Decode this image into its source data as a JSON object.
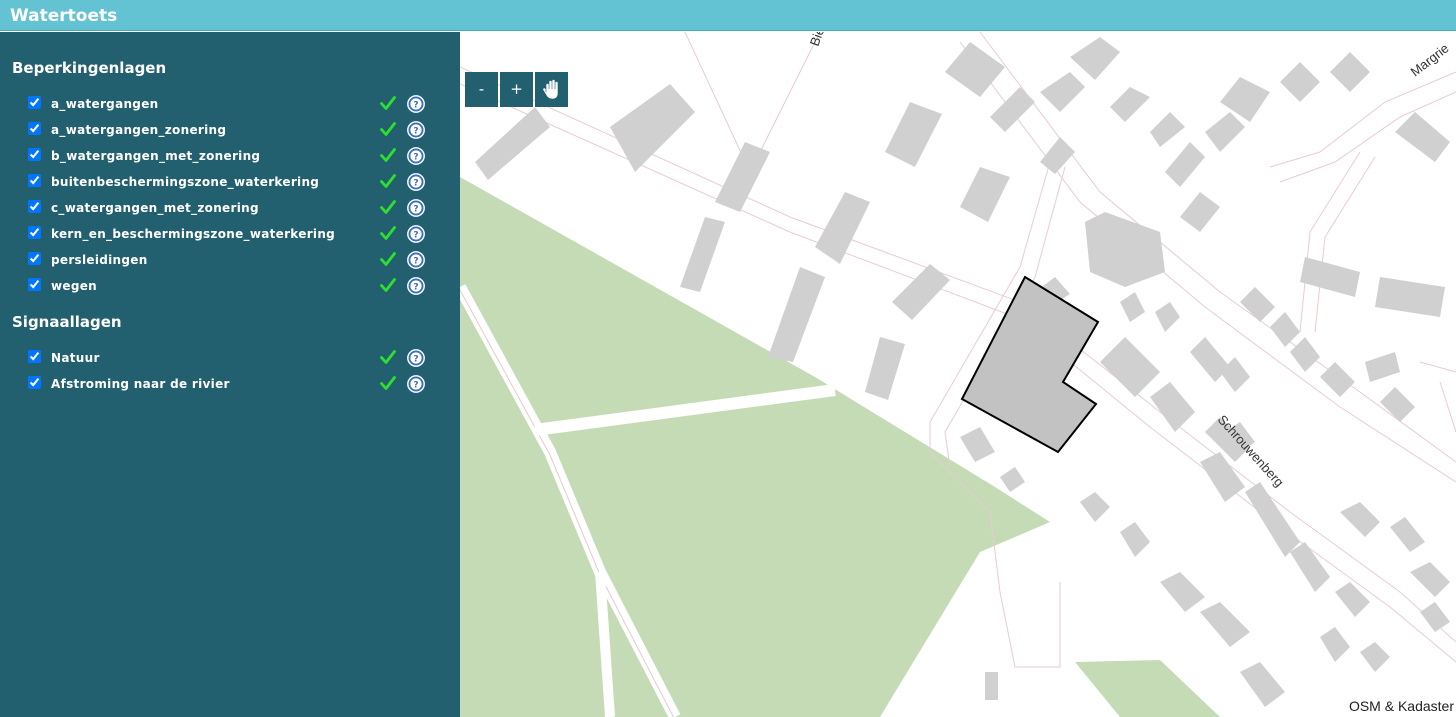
{
  "app": {
    "title": "Watertoets"
  },
  "sections": [
    {
      "title": "Beperkingenlagen"
    },
    {
      "title": "Signaallagen"
    }
  ],
  "beperkingenlagen": [
    {
      "label": "a_watergangen",
      "checked": true
    },
    {
      "label": "a_watergangen_zonering",
      "checked": true
    },
    {
      "label": "b_watergangen_met_zonering",
      "checked": true
    },
    {
      "label": "buitenbeschermingszone_waterkering",
      "checked": true
    },
    {
      "label": "c_watergangen_met_zonering",
      "checked": true
    },
    {
      "label": "kern_en_beschermingszone_waterkering",
      "checked": true
    },
    {
      "label": "persleidingen",
      "checked": true
    },
    {
      "label": "wegen",
      "checked": true
    }
  ],
  "signaallagen": [
    {
      "label": "Natuur",
      "checked": true
    },
    {
      "label": "Afstroming naar de rivier",
      "checked": true
    }
  ],
  "map": {
    "controls": {
      "zoom_out": "-",
      "zoom_in": "+",
      "pan_icon": "hand-icon"
    },
    "street_labels": [
      "Schrouwenberg",
      "Margrie",
      "Bie"
    ],
    "attribution": "OSM & Kadaster"
  },
  "colors": {
    "header": "#64c3d2",
    "sidebar": "#22606f",
    "check": "#2ee02e",
    "help": "#3a6fc4",
    "park": "#c4dbb5",
    "building": "#d0d0d0",
    "selection": "#c2c2c2"
  },
  "icons": {
    "status": "checkmark-icon",
    "help": "help-icon"
  }
}
